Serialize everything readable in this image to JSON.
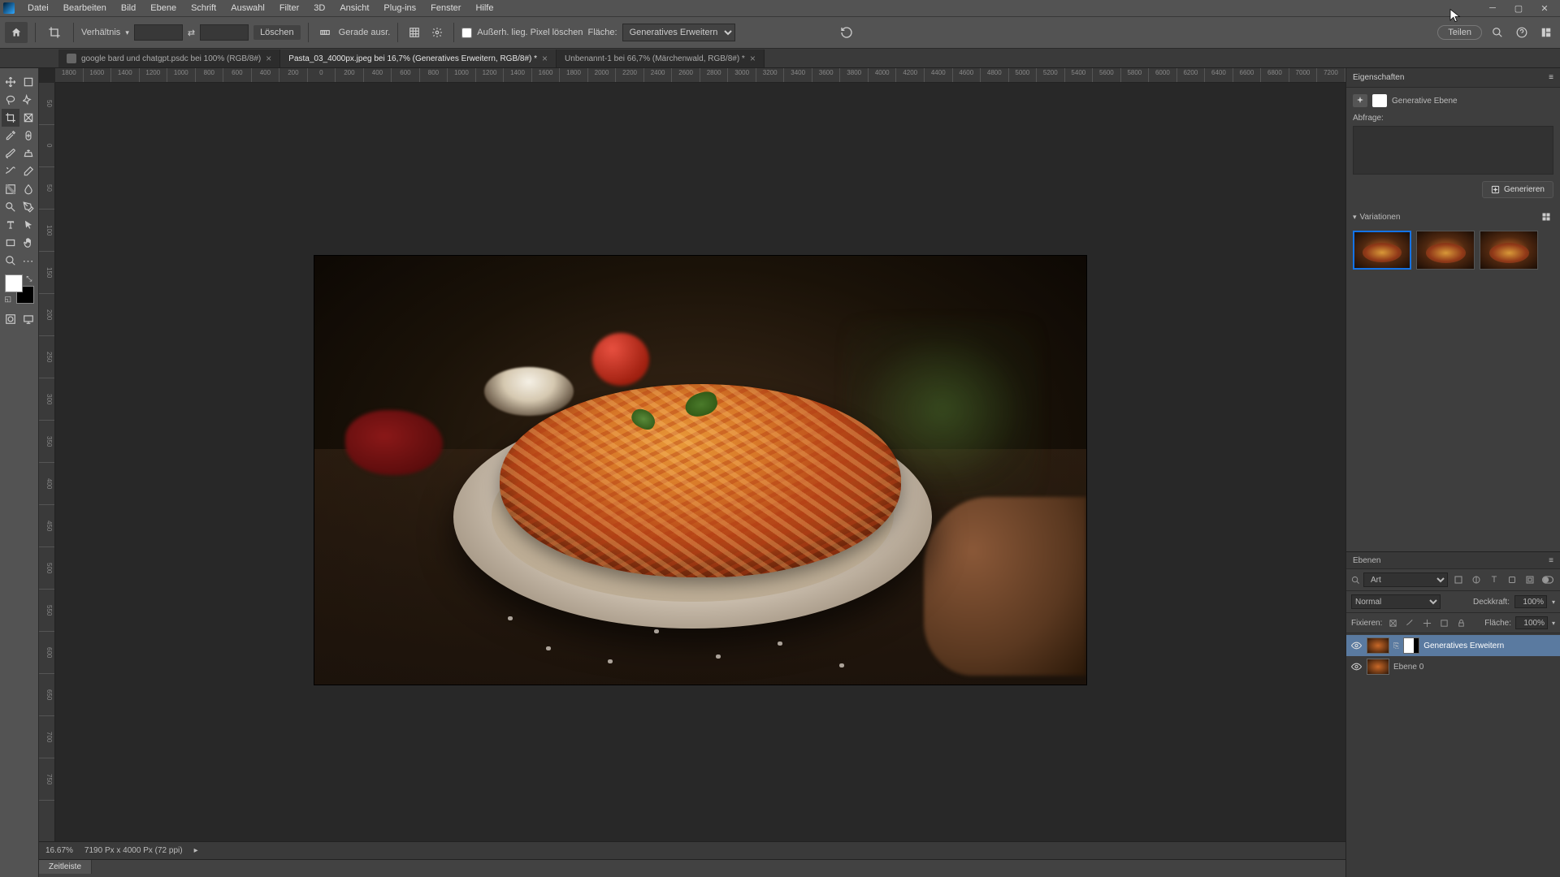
{
  "menu": {
    "items": [
      "Datei",
      "Bearbeiten",
      "Bild",
      "Ebene",
      "Schrift",
      "Auswahl",
      "Filter",
      "3D",
      "Ansicht",
      "Plug-ins",
      "Fenster",
      "Hilfe"
    ]
  },
  "options": {
    "ratio_label": "Verhältnis",
    "clear": "Löschen",
    "straighten": "Gerade ausr.",
    "delete_cropped": "Außerh. lieg. Pixel löschen",
    "fill_label": "Fläche:",
    "fill_select": "Generatives Erweitern",
    "share": "Teilen"
  },
  "tabs": [
    {
      "label": "google bard und chatgpt.psdc bei 100% (RGB/8#)",
      "active": false
    },
    {
      "label": "Pasta_03_4000px.jpeg bei 16,7% (Generatives Erweitern, RGB/8#) *",
      "active": true
    },
    {
      "label": "Unbenannt-1 bei 66,7% (Märchenwald, RGB/8#) *",
      "active": false
    }
  ],
  "ruler_h": [
    "1800",
    "1600",
    "1400",
    "1200",
    "1000",
    "800",
    "600",
    "400",
    "200",
    "0",
    "200",
    "400",
    "600",
    "800",
    "1000",
    "1200",
    "1400",
    "1600",
    "1800",
    "2000",
    "2200",
    "2400",
    "2600",
    "2800",
    "3000",
    "3200",
    "3400",
    "3600",
    "3800",
    "4000",
    "4200",
    "4400",
    "4600",
    "4800",
    "5000",
    "5200",
    "5400",
    "5600",
    "5800",
    "6000",
    "6200",
    "6400",
    "6600",
    "6800",
    "7000",
    "7200"
  ],
  "ruler_v": [
    "50",
    "0",
    "50",
    "100",
    "150",
    "200",
    "250",
    "300",
    "350",
    "400",
    "450",
    "500",
    "550",
    "600",
    "650",
    "700",
    "750"
  ],
  "status": {
    "zoom": "16.67%",
    "info": "7190 Px x 4000 Px (72 ppi)"
  },
  "timeline": "Zeitleiste",
  "properties": {
    "title": "Eigenschaften",
    "layer_type": "Generative Ebene",
    "query_label": "Abfrage:",
    "generate": "Generieren",
    "variations": "Variationen"
  },
  "layers": {
    "title": "Ebenen",
    "search_kind": "Art",
    "blend": "Normal",
    "opacity_label": "Deckkraft:",
    "opacity": "100%",
    "lock_label": "Fixieren:",
    "fill_label": "Fläche:",
    "fill": "100%",
    "items": [
      {
        "name": "Generatives Erweitern",
        "selected": true,
        "has_mask": true
      },
      {
        "name": "Ebene 0",
        "selected": false,
        "has_mask": false
      }
    ]
  }
}
